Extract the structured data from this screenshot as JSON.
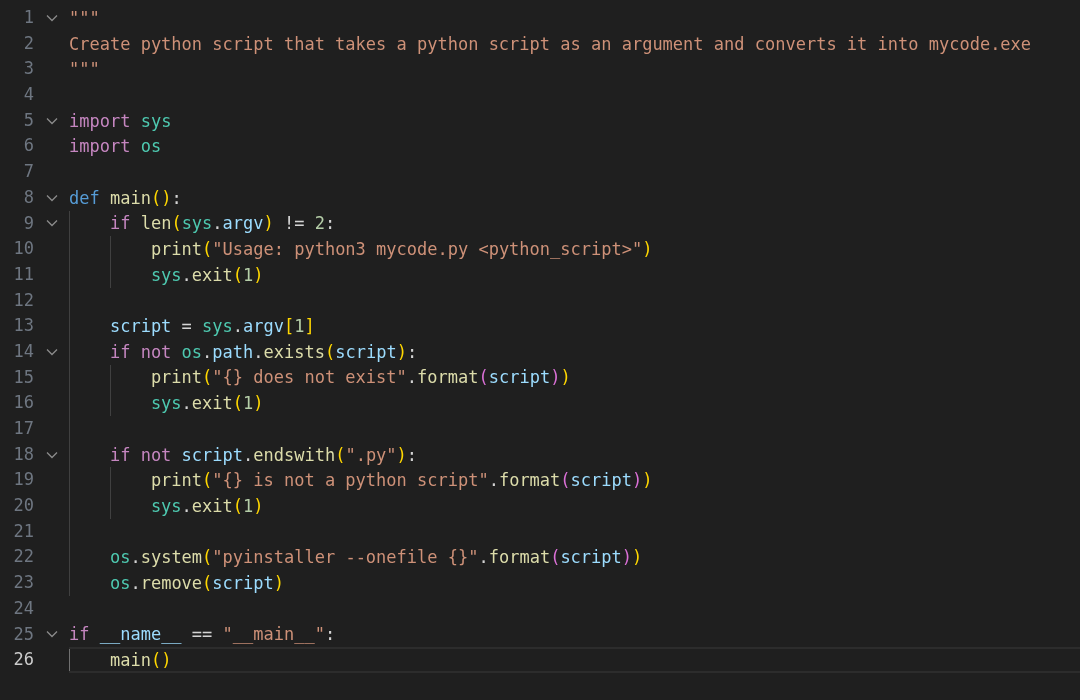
{
  "editor": {
    "lines": [
      {
        "number": "1",
        "foldable": true,
        "current": false,
        "tokens": [
          {
            "text": "\"\"\"",
            "kind": "str"
          }
        ]
      },
      {
        "number": "2",
        "foldable": false,
        "current": false,
        "tokens": [
          {
            "text": "Create python script that takes a python script as an argument and converts it into mycode.exe",
            "kind": "str"
          }
        ]
      },
      {
        "number": "3",
        "foldable": false,
        "current": false,
        "tokens": [
          {
            "text": "\"\"\"",
            "kind": "str"
          }
        ]
      },
      {
        "number": "4",
        "foldable": false,
        "current": false
      },
      {
        "number": "5",
        "foldable": true,
        "current": false,
        "tokens": [
          {
            "text": "import ",
            "kind": "ctl"
          },
          {
            "text": "sys",
            "kind": "mod"
          }
        ]
      },
      {
        "number": "6",
        "foldable": false,
        "current": false,
        "tokens": [
          {
            "text": "import ",
            "kind": "ctl"
          },
          {
            "text": "os",
            "kind": "mod"
          }
        ]
      },
      {
        "number": "7",
        "foldable": false,
        "current": false
      },
      {
        "number": "8",
        "foldable": true,
        "current": false,
        "tokens": [
          {
            "text": "def ",
            "kind": "kw"
          },
          {
            "text": "main",
            "kind": "fn"
          },
          {
            "text": "()",
            "kind": "b1"
          },
          {
            "text": ":",
            "kind": "op"
          }
        ]
      },
      {
        "number": "9",
        "foldable": true,
        "current": false,
        "tokens": [
          {
            "text": "    if ",
            "kind": "ctl"
          },
          {
            "text": "len",
            "kind": "fn"
          },
          {
            "text": "(",
            "kind": "b1"
          },
          {
            "text": "sys",
            "kind": "mod"
          },
          {
            "text": ".",
            "kind": "op"
          },
          {
            "text": "argv",
            "kind": "var"
          },
          {
            "text": ")",
            "kind": "b1"
          },
          {
            "text": " != ",
            "kind": "op"
          },
          {
            "text": "2",
            "kind": "num"
          },
          {
            "text": ":",
            "kind": "op"
          }
        ]
      },
      {
        "number": "10",
        "foldable": false,
        "current": false,
        "tokens": [
          {
            "text": "        print",
            "kind": "fn"
          },
          {
            "text": "(",
            "kind": "b1"
          },
          {
            "text": "\"Usage: python3 mycode.py <python_script>\"",
            "kind": "str"
          },
          {
            "text": ")",
            "kind": "b1"
          }
        ]
      },
      {
        "number": "11",
        "foldable": false,
        "current": false,
        "tokens": [
          {
            "text": "        sys",
            "kind": "mod"
          },
          {
            "text": ".",
            "kind": "op"
          },
          {
            "text": "exit",
            "kind": "fn"
          },
          {
            "text": "(",
            "kind": "b1"
          },
          {
            "text": "1",
            "kind": "num"
          },
          {
            "text": ")",
            "kind": "b1"
          }
        ]
      },
      {
        "number": "12",
        "foldable": false,
        "current": false
      },
      {
        "number": "13",
        "foldable": false,
        "current": false,
        "tokens": [
          {
            "text": "    script",
            "kind": "var"
          },
          {
            "text": " = ",
            "kind": "op"
          },
          {
            "text": "sys",
            "kind": "mod"
          },
          {
            "text": ".",
            "kind": "op"
          },
          {
            "text": "argv",
            "kind": "var"
          },
          {
            "text": "[",
            "kind": "b1"
          },
          {
            "text": "1",
            "kind": "num"
          },
          {
            "text": "]",
            "kind": "b1"
          }
        ]
      },
      {
        "number": "14",
        "foldable": true,
        "current": false,
        "tokens": [
          {
            "text": "    if not ",
            "kind": "ctl"
          },
          {
            "text": "os",
            "kind": "mod"
          },
          {
            "text": ".",
            "kind": "op"
          },
          {
            "text": "path",
            "kind": "var"
          },
          {
            "text": ".",
            "kind": "op"
          },
          {
            "text": "exists",
            "kind": "fn"
          },
          {
            "text": "(",
            "kind": "b1"
          },
          {
            "text": "script",
            "kind": "var"
          },
          {
            "text": ")",
            "kind": "b1"
          },
          {
            "text": ":",
            "kind": "op"
          }
        ]
      },
      {
        "number": "15",
        "foldable": false,
        "current": false,
        "tokens": [
          {
            "text": "        print",
            "kind": "fn"
          },
          {
            "text": "(",
            "kind": "b1"
          },
          {
            "text": "\"{} does not exist\"",
            "kind": "str"
          },
          {
            "text": ".",
            "kind": "op"
          },
          {
            "text": "format",
            "kind": "fn"
          },
          {
            "text": "(",
            "kind": "b2"
          },
          {
            "text": "script",
            "kind": "var"
          },
          {
            "text": ")",
            "kind": "b2"
          },
          {
            "text": ")",
            "kind": "b1"
          }
        ]
      },
      {
        "number": "16",
        "foldable": false,
        "current": false,
        "tokens": [
          {
            "text": "        sys",
            "kind": "mod"
          },
          {
            "text": ".",
            "kind": "op"
          },
          {
            "text": "exit",
            "kind": "fn"
          },
          {
            "text": "(",
            "kind": "b1"
          },
          {
            "text": "1",
            "kind": "num"
          },
          {
            "text": ")",
            "kind": "b1"
          }
        ]
      },
      {
        "number": "17",
        "foldable": false,
        "current": false
      },
      {
        "number": "18",
        "foldable": true,
        "current": false,
        "tokens": [
          {
            "text": "    if not ",
            "kind": "ctl"
          },
          {
            "text": "script",
            "kind": "var"
          },
          {
            "text": ".",
            "kind": "op"
          },
          {
            "text": "endswith",
            "kind": "fn"
          },
          {
            "text": "(",
            "kind": "b1"
          },
          {
            "text": "\".py\"",
            "kind": "str"
          },
          {
            "text": ")",
            "kind": "b1"
          },
          {
            "text": ":",
            "kind": "op"
          }
        ]
      },
      {
        "number": "19",
        "foldable": false,
        "current": false,
        "tokens": [
          {
            "text": "        print",
            "kind": "fn"
          },
          {
            "text": "(",
            "kind": "b1"
          },
          {
            "text": "\"{} is not a python script\"",
            "kind": "str"
          },
          {
            "text": ".",
            "kind": "op"
          },
          {
            "text": "format",
            "kind": "fn"
          },
          {
            "text": "(",
            "kind": "b2"
          },
          {
            "text": "script",
            "kind": "var"
          },
          {
            "text": ")",
            "kind": "b2"
          },
          {
            "text": ")",
            "kind": "b1"
          }
        ]
      },
      {
        "number": "20",
        "foldable": false,
        "current": false,
        "tokens": [
          {
            "text": "        sys",
            "kind": "mod"
          },
          {
            "text": ".",
            "kind": "op"
          },
          {
            "text": "exit",
            "kind": "fn"
          },
          {
            "text": "(",
            "kind": "b1"
          },
          {
            "text": "1",
            "kind": "num"
          },
          {
            "text": ")",
            "kind": "b1"
          }
        ]
      },
      {
        "number": "21",
        "foldable": false,
        "current": false
      },
      {
        "number": "22",
        "foldable": false,
        "current": false,
        "tokens": [
          {
            "text": "    os",
            "kind": "mod"
          },
          {
            "text": ".",
            "kind": "op"
          },
          {
            "text": "system",
            "kind": "fn"
          },
          {
            "text": "(",
            "kind": "b1"
          },
          {
            "text": "\"pyinstaller --onefile {}\"",
            "kind": "str"
          },
          {
            "text": ".",
            "kind": "op"
          },
          {
            "text": "format",
            "kind": "fn"
          },
          {
            "text": "(",
            "kind": "b2"
          },
          {
            "text": "script",
            "kind": "var"
          },
          {
            "text": ")",
            "kind": "b2"
          },
          {
            "text": ")",
            "kind": "b1"
          }
        ]
      },
      {
        "number": "23",
        "foldable": false,
        "current": false,
        "tokens": [
          {
            "text": "    os",
            "kind": "mod"
          },
          {
            "text": ".",
            "kind": "op"
          },
          {
            "text": "remove",
            "kind": "fn"
          },
          {
            "text": "(",
            "kind": "b1"
          },
          {
            "text": "script",
            "kind": "var"
          },
          {
            "text": ")",
            "kind": "b1"
          }
        ]
      },
      {
        "number": "24",
        "foldable": false,
        "current": false
      },
      {
        "number": "25",
        "foldable": true,
        "current": false,
        "tokens": [
          {
            "text": "if ",
            "kind": "ctl"
          },
          {
            "text": "__name__",
            "kind": "var"
          },
          {
            "text": " == ",
            "kind": "op"
          },
          {
            "text": "\"__main__\"",
            "kind": "str"
          },
          {
            "text": ":",
            "kind": "op"
          }
        ]
      },
      {
        "number": "26",
        "foldable": false,
        "current": true,
        "tokens": [
          {
            "text": "    main",
            "kind": "fn"
          },
          {
            "text": "()",
            "kind": "b1"
          }
        ]
      }
    ]
  }
}
